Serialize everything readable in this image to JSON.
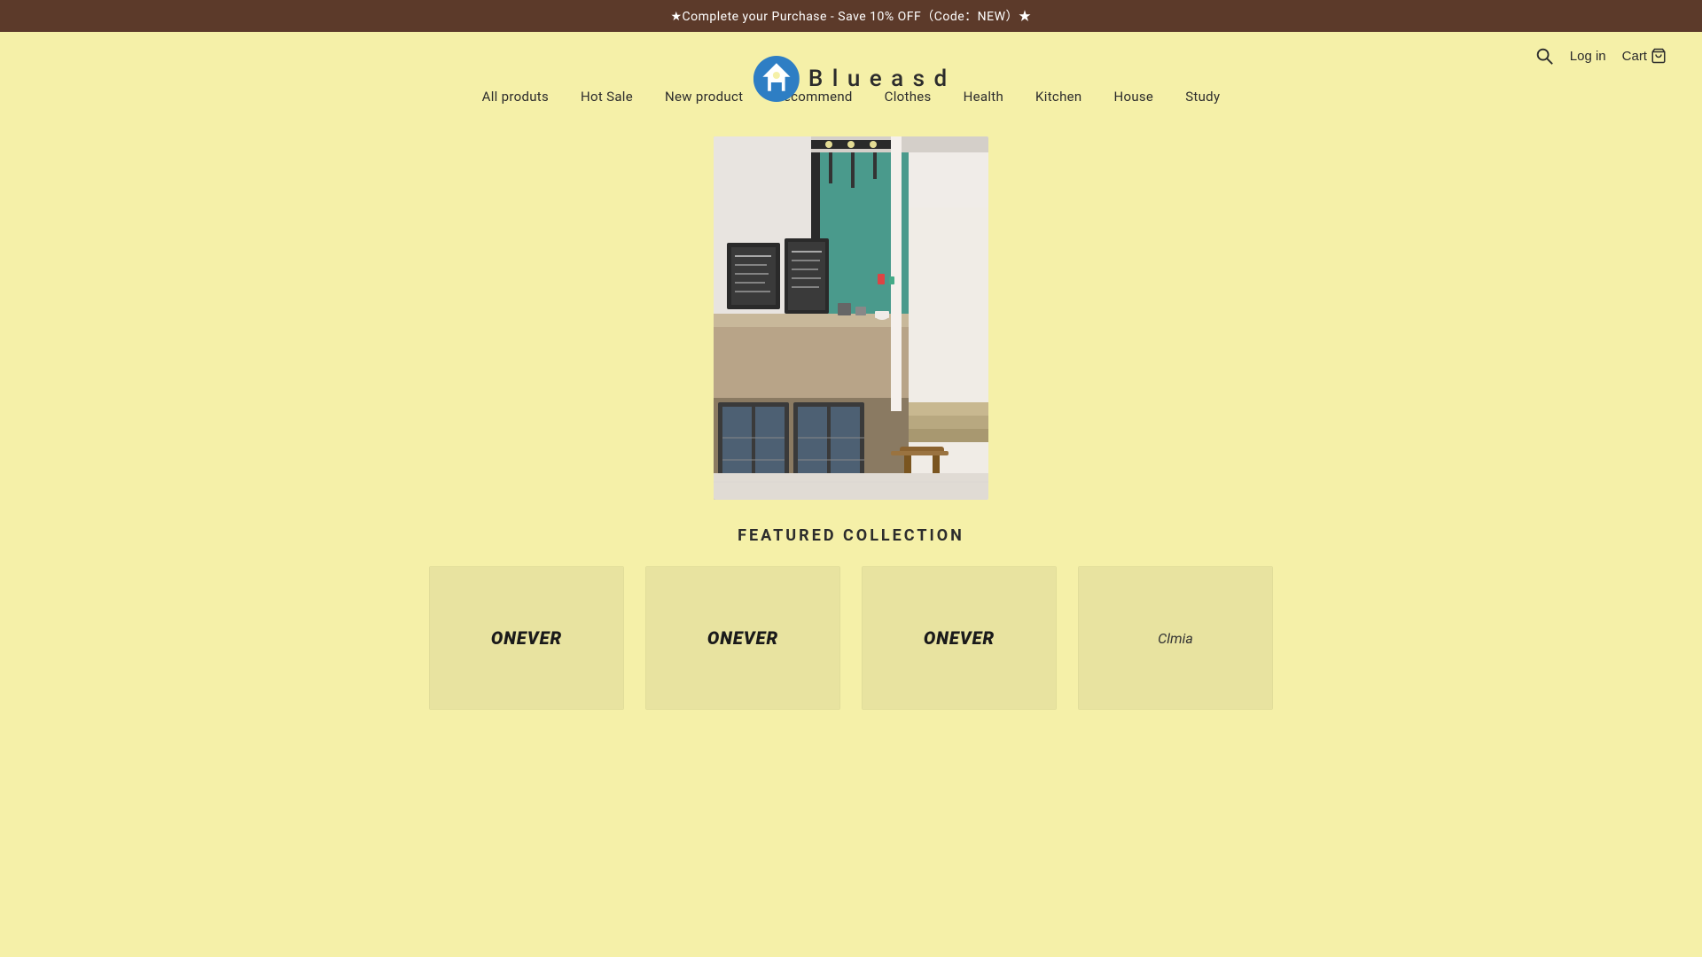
{
  "announcement": {
    "text": "★Complete your Purchase - Save 10% OFF（Code：NEW）★"
  },
  "header": {
    "logo_text": "B l u e a s d",
    "search_label": "Search",
    "login_label": "Log in",
    "cart_label": "Cart"
  },
  "nav": {
    "items": [
      {
        "label": "All produts",
        "id": "all-produts"
      },
      {
        "label": "Hot Sale",
        "id": "hot-sale"
      },
      {
        "label": "New product",
        "id": "new-product"
      },
      {
        "label": "Recommend",
        "id": "recommend"
      },
      {
        "label": "Clothes",
        "id": "clothes"
      },
      {
        "label": "Health",
        "id": "health"
      },
      {
        "label": "Kitchen",
        "id": "kitchen"
      },
      {
        "label": "House",
        "id": "house"
      },
      {
        "label": "Study",
        "id": "study"
      }
    ]
  },
  "featured": {
    "title": "FEATURED COLLECTION",
    "products": [
      {
        "brand": "ONEVER",
        "type": "onever"
      },
      {
        "brand": "ONEVER",
        "type": "onever"
      },
      {
        "brand": "ONEVER",
        "type": "onever"
      },
      {
        "brand": "Clmia",
        "type": "clmia"
      }
    ]
  }
}
